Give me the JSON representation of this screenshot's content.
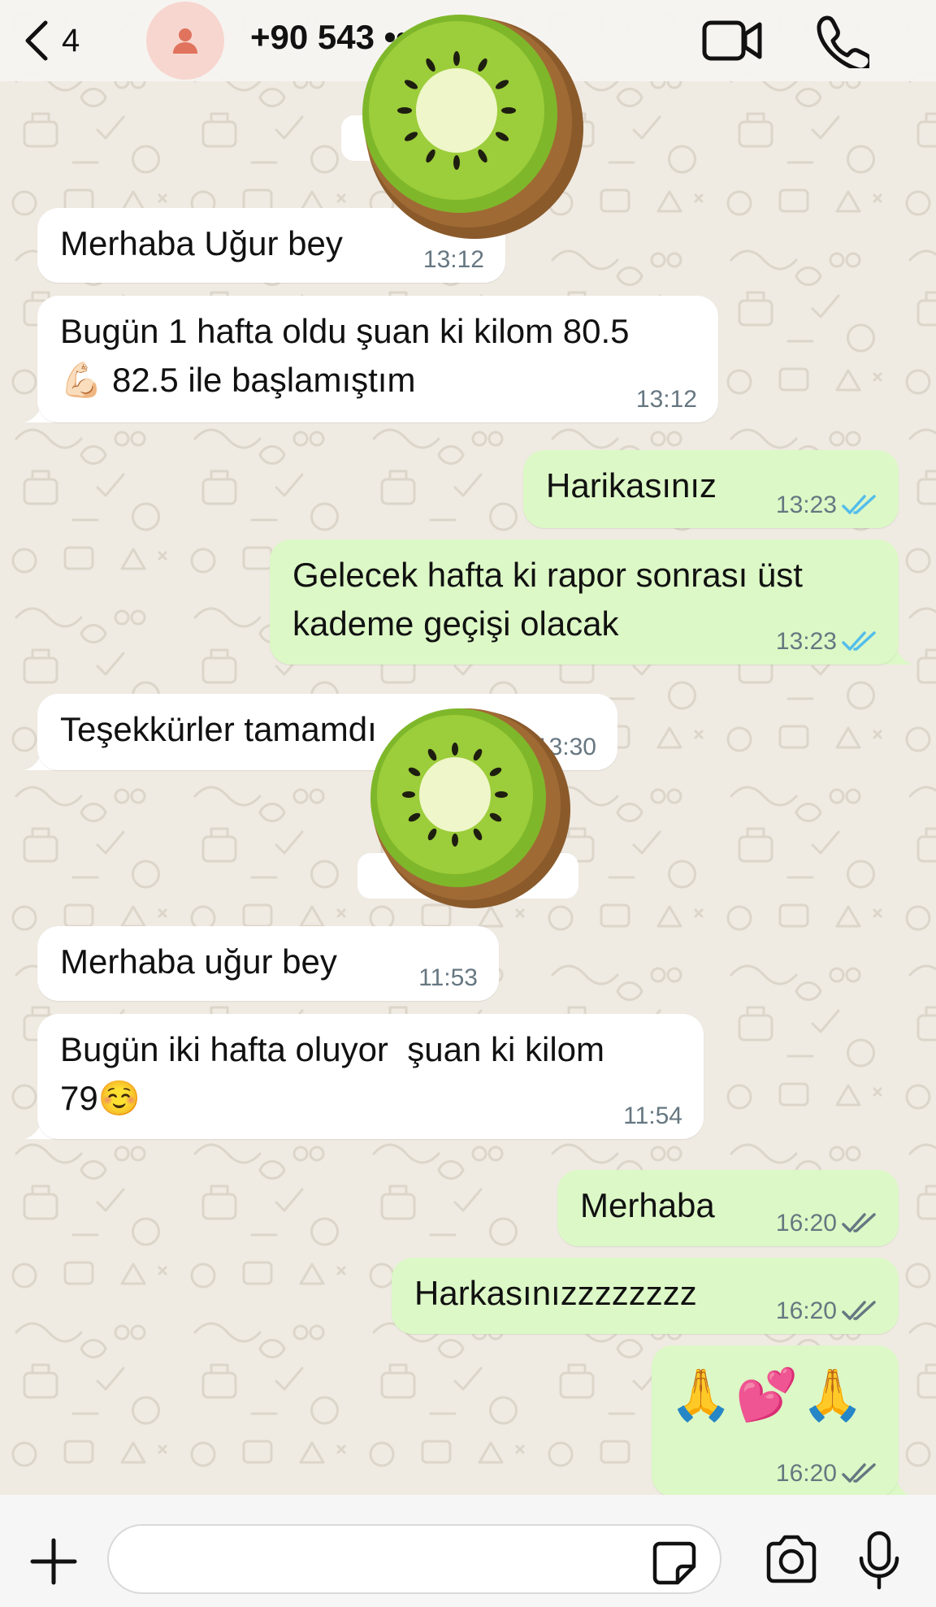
{
  "header": {
    "back_count": "4",
    "contact_name": "+90 543 ••• •• 65"
  },
  "colors": {
    "chat_background": "#efeae2",
    "incoming_bubble": "#ffffff",
    "outgoing_bubble": "#dcf8c6",
    "read_ticks": "#53bdeb",
    "delivered_ticks": "#667781",
    "avatar_background": "#f7d6cf",
    "avatar_icon": "#e0735e"
  },
  "messages": [
    {
      "direction": "incoming",
      "text": "Merhaba Uğur bey",
      "time": "13:12"
    },
    {
      "direction": "incoming",
      "text": "Bugün 1 hafta oldu şuan ki kilom 80.5\n💪🏻 82.5 ile başlamıştım",
      "time": "13:12"
    },
    {
      "direction": "outgoing",
      "text": "Harikasınız",
      "time": "13:23",
      "status": "read"
    },
    {
      "direction": "outgoing",
      "text": "Gelecek hafta ki rapor sonrası üst\nkademe geçişi olacak",
      "time": "13:23",
      "status": "read"
    },
    {
      "direction": "incoming",
      "text": "Teşekkürler tamamdı",
      "time": "13:30"
    },
    {
      "direction": "incoming",
      "text": "Merhaba uğur bey",
      "time": "11:53"
    },
    {
      "direction": "incoming",
      "text": "Bugün iki hafta oluyor  şuan ki kilom\n79☺️",
      "time": "11:54"
    },
    {
      "direction": "outgoing",
      "text": "Merhaba",
      "time": "16:20",
      "status": "delivered"
    },
    {
      "direction": "outgoing",
      "text": "Harkasınızzzzzzzz",
      "time": "16:20",
      "status": "delivered"
    },
    {
      "direction": "outgoing",
      "text": "🙏💕🙏",
      "time": "16:20",
      "status": "delivered"
    }
  ],
  "icons": {
    "back": "chevron-left-icon",
    "avatar": "person-icon",
    "video": "video-camera-icon",
    "call": "phone-icon",
    "attach": "plus-icon",
    "sticker": "sticker-icon",
    "camera": "camera-icon",
    "mic": "microphone-icon",
    "redaction": "kiwi-sticker"
  },
  "composer": {
    "placeholder": ""
  }
}
